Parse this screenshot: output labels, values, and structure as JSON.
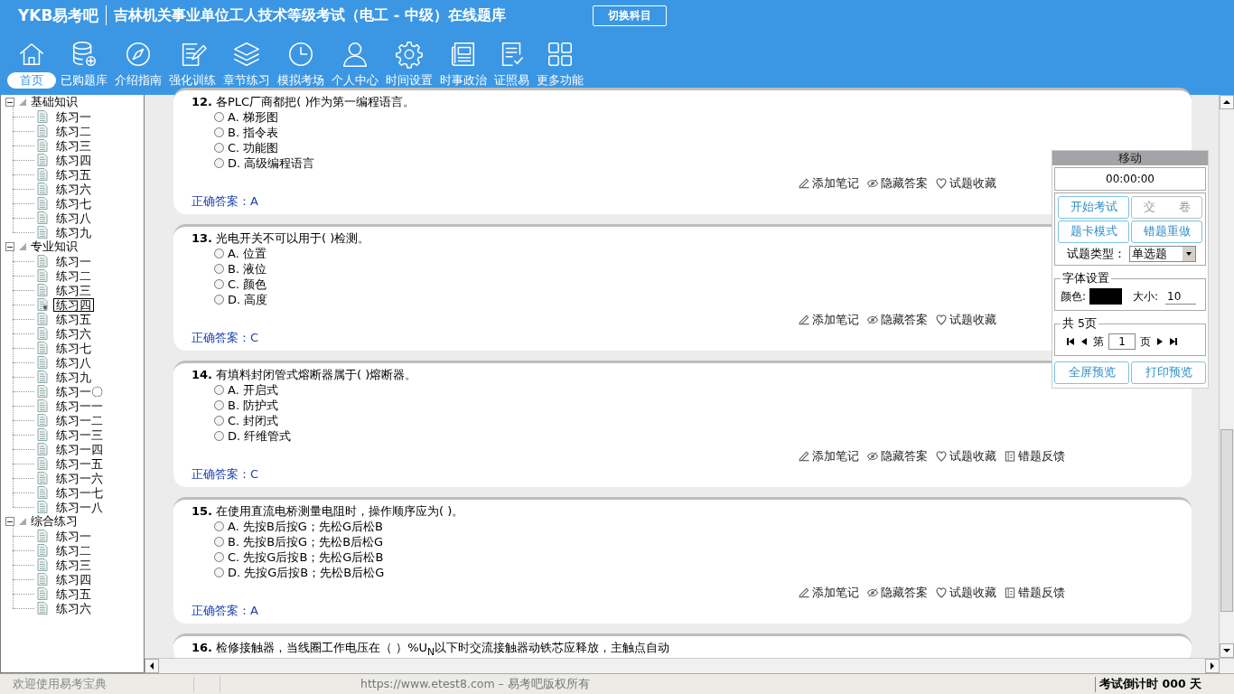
{
  "header": {
    "logo": "YKB易考吧",
    "title": "吉林机关事业单位工人技术等级考试（电工 - 中级）在线题库",
    "switch_button": "切换科目"
  },
  "nav": [
    {
      "label": "首页",
      "selected": true
    },
    {
      "label": "已购题库",
      "selected": false
    },
    {
      "label": "介绍指南",
      "selected": false
    },
    {
      "label": "强化训练",
      "selected": false
    },
    {
      "label": "章节练习",
      "selected": false
    },
    {
      "label": "模拟考场",
      "selected": false
    },
    {
      "label": "个人中心",
      "selected": false
    },
    {
      "label": "时间设置",
      "selected": false
    },
    {
      "label": "时事政治",
      "selected": false
    },
    {
      "label": "证照易",
      "selected": false
    },
    {
      "label": "更多功能",
      "selected": false
    }
  ],
  "tree": [
    {
      "label": "基础知识",
      "expanded": true,
      "children": [
        {
          "label": "练习一",
          "selected": false
        },
        {
          "label": "练习二",
          "selected": false
        },
        {
          "label": "练习三",
          "selected": false
        },
        {
          "label": "练习四",
          "selected": false
        },
        {
          "label": "练习五",
          "selected": false
        },
        {
          "label": "练习六",
          "selected": false
        },
        {
          "label": "练习七",
          "selected": false
        },
        {
          "label": "练习八",
          "selected": false
        },
        {
          "label": "练习九",
          "selected": false
        }
      ]
    },
    {
      "label": "专业知识",
      "expanded": true,
      "children": [
        {
          "label": "练习一",
          "selected": false
        },
        {
          "label": "练习二",
          "selected": false
        },
        {
          "label": "练习三",
          "selected": false
        },
        {
          "label": "练习四",
          "selected": true
        },
        {
          "label": "练习五",
          "selected": false
        },
        {
          "label": "练习六",
          "selected": false
        },
        {
          "label": "练习七",
          "selected": false
        },
        {
          "label": "练习八",
          "selected": false
        },
        {
          "label": "练习九",
          "selected": false
        },
        {
          "label": "练习一〇",
          "selected": false
        },
        {
          "label": "练习一一",
          "selected": false
        },
        {
          "label": "练习一二",
          "selected": false
        },
        {
          "label": "练习一三",
          "selected": false
        },
        {
          "label": "练习一四",
          "selected": false
        },
        {
          "label": "练习一五",
          "selected": false
        },
        {
          "label": "练习一六",
          "selected": false
        },
        {
          "label": "练习一七",
          "selected": false
        },
        {
          "label": "练习一八",
          "selected": false
        }
      ]
    },
    {
      "label": "综合练习",
      "expanded": true,
      "children": [
        {
          "label": "练习一",
          "selected": false
        },
        {
          "label": "练习二",
          "selected": false
        },
        {
          "label": "练习三",
          "selected": false
        },
        {
          "label": "练习四",
          "selected": false
        },
        {
          "label": "练习五",
          "selected": false
        },
        {
          "label": "练习六",
          "selected": false
        }
      ]
    }
  ],
  "questions": [
    {
      "number": "12.",
      "text": "各PLC厂商都把( )作为第一编程语言。",
      "options": [
        {
          "label": "A. 梯形图",
          "selected": false
        },
        {
          "label": "B. 指令表",
          "selected": false
        },
        {
          "label": "C. 功能图",
          "selected": false
        },
        {
          "label": "D. 高级编程语言",
          "selected": false
        }
      ],
      "actions": [
        "添加笔记",
        "隐藏答案",
        "试题收藏"
      ],
      "answer": "正确答案：A"
    },
    {
      "number": "13.",
      "text": "光电开关不可以用于( )检测。",
      "options": [
        {
          "label": "A. 位置",
          "selected": false
        },
        {
          "label": "B. 液位",
          "selected": false
        },
        {
          "label": "C. 颜色",
          "selected": false
        },
        {
          "label": "D. 高度",
          "selected": false
        }
      ],
      "actions": [
        "添加笔记",
        "隐藏答案",
        "试题收藏"
      ],
      "answer": "正确答案：C"
    },
    {
      "number": "14.",
      "text": "有填料封闭管式熔断器属于( )熔断器。",
      "options": [
        {
          "label": "A. 开启式",
          "selected": false
        },
        {
          "label": "B. 防护式",
          "selected": false
        },
        {
          "label": "C. 封闭式",
          "selected": false
        },
        {
          "label": "D. 纤维管式",
          "selected": false
        }
      ],
      "actions": [
        "添加笔记",
        "隐藏答案",
        "试题收藏",
        "错题反馈"
      ],
      "answer": "正确答案：C"
    },
    {
      "number": "15.",
      "text": "在使用直流电桥测量电阻时，操作顺序应为( )。",
      "options": [
        {
          "label": "A. 先按B后按G；先松G后松B",
          "selected": false
        },
        {
          "label": "B. 先按B后按G；先松B后松G",
          "selected": false
        },
        {
          "label": "C. 先按G后按B；先松G后松B",
          "selected": false
        },
        {
          "label": "D. 先按G后按B；先松B后松G",
          "selected": false
        }
      ],
      "actions": [
        "添加笔记",
        "隐藏答案",
        "试题收藏",
        "错题反馈"
      ],
      "answer": "正确答案：A"
    },
    {
      "number": "16.",
      "text": "检修接触器，当线圈工作电压在（ ）%U$_{N}$以下时交流接触器动铁芯应释放，主触点自动"
    }
  ],
  "panel": {
    "title": "移动",
    "timer": "00:00:00",
    "buttons": [
      {
        "label": "开始考试",
        "disabled": false
      },
      {
        "label": "交　　卷",
        "disabled": true
      },
      {
        "label": "题卡模式",
        "disabled": false
      },
      {
        "label": "错题重做",
        "disabled": false
      }
    ],
    "type_label": "试题类型：",
    "type_value": "单选题",
    "font_legend": "字体设置",
    "color_label": "颜色:",
    "color": "#000000",
    "size_label": "大小:",
    "size_value": "10",
    "pages_legend": "共 5页",
    "page_prefix": "第",
    "page_value": "1",
    "page_suffix": "页",
    "preview_buttons": [
      "全屏预览",
      "打印预览"
    ]
  },
  "status_bar": {
    "welcome": "欢迎使用易考宝典",
    "copyright": "https://www.etest8.com – 易考吧版权所有",
    "countdown": "考试倒计时 000 天"
  }
}
